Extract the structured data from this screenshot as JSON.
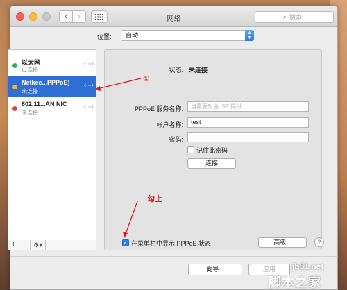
{
  "window": {
    "title": "网络"
  },
  "search": {
    "placeholder": "搜索"
  },
  "location": {
    "label": "位置:",
    "value": "自动"
  },
  "services": [
    {
      "name": "以太网",
      "status": "已连接",
      "dot": "#2fb34a"
    },
    {
      "name": "Netkee...PPPoE)",
      "status": "未连接",
      "dot": "#f0b42c"
    },
    {
      "name": "802.11...AN NIC",
      "status": "未连接",
      "dot": "#e2403a"
    }
  ],
  "sidebar_toolbar": {
    "add": "+",
    "remove": "−",
    "gear": "⚙▾"
  },
  "detail": {
    "status_label": "状态:",
    "status_value": "未连接",
    "service_name_label": "PPPoE 服务名称:",
    "service_name_placeholder": "当需要时由 ISP 提供",
    "account_label": "帐户名称:",
    "account_value": "test",
    "password_label": "密码:",
    "password_value": "",
    "remember_label": "记住此密码",
    "connect_button": "连接"
  },
  "bottom": {
    "menubar_label": "在菜单栏中显示 PPPoE 状态",
    "menubar_checked": true,
    "advanced_button": "高级...",
    "help_button": "?"
  },
  "footer": {
    "assist_button": "向导...",
    "apply_button": "应用"
  },
  "annotations": {
    "num": "①",
    "check": "勾上"
  },
  "watermark": {
    "site": "jb51.net",
    "brand": "脚本之家"
  }
}
